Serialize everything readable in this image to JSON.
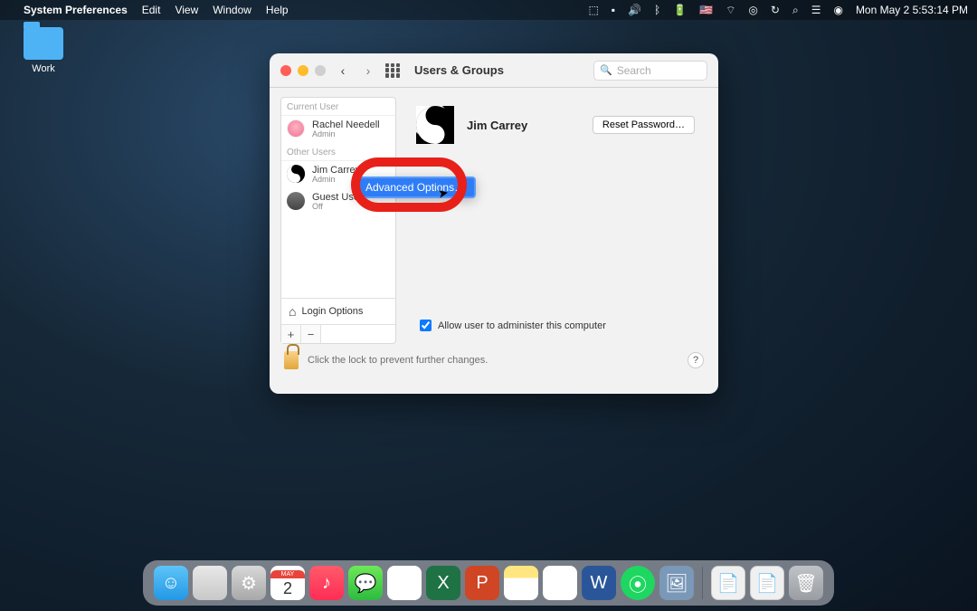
{
  "menubar": {
    "app_name": "System Preferences",
    "items": [
      "Edit",
      "View",
      "Window",
      "Help"
    ],
    "clock": "Mon May 2  5:53:14 PM"
  },
  "desktop": {
    "folder_label": "Work"
  },
  "window": {
    "title": "Users & Groups",
    "search_placeholder": "Search"
  },
  "sidebar": {
    "current_header": "Current User",
    "other_header": "Other Users",
    "current_user": {
      "name": "Rachel Needell",
      "role": "Admin"
    },
    "others": [
      {
        "name": "Jim Carrey",
        "role": "Admin"
      },
      {
        "name": "Guest User",
        "role": "Off"
      }
    ],
    "login_options": "Login Options"
  },
  "detail": {
    "name": "Jim Carrey",
    "reset_label": "Reset Password…",
    "admin_label": "Allow user to administer this computer",
    "admin_checked": true
  },
  "context_menu": {
    "item": "Advanced Options…"
  },
  "lock_row": {
    "text": "Click the lock to prevent further changes."
  },
  "dock": {
    "cal_month": "MAY",
    "cal_day": "2"
  }
}
